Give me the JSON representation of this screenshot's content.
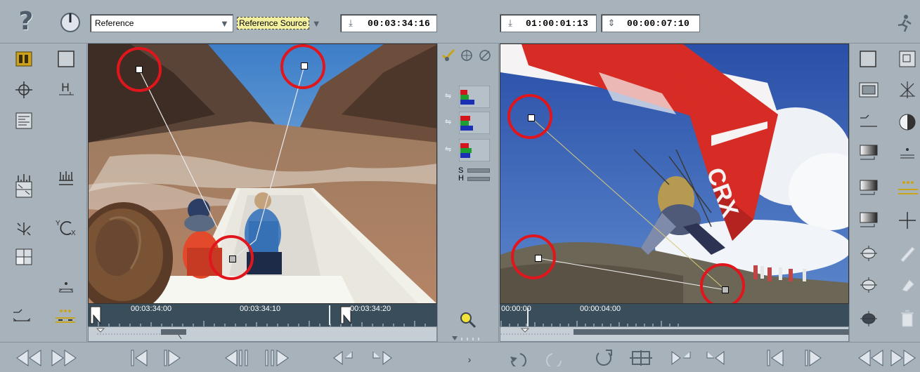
{
  "header": {
    "help_label": "?",
    "reference_select": "Reference",
    "reference_source_label": "Reference Source",
    "ref_timecode": "00:03:34:16",
    "master_timecode": "01:00:01:13",
    "duration_timecode": "00:00:07:10"
  },
  "source_monitor": {
    "ruler_labels": [
      "00:03:34:00",
      "00:03:34:10",
      "00:03:34:20"
    ]
  },
  "record_monitor": {
    "ruler_labels": [
      "00:00:00",
      "00:00:04:00"
    ]
  },
  "middle": {
    "s_label": "S",
    "h_label": "H"
  },
  "colors": {
    "panel": "#a7b2bb",
    "highlight": "#e0161c",
    "accent_yellow": "#f3e23a"
  }
}
